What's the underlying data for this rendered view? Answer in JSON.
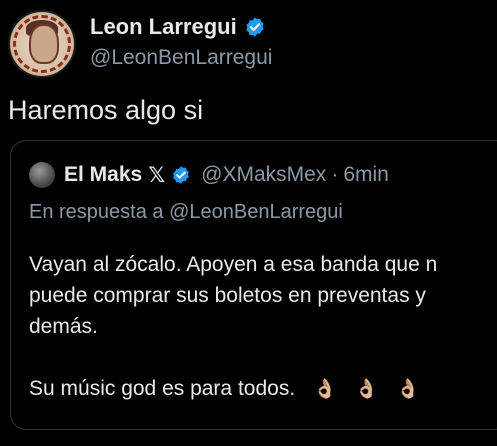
{
  "tweet": {
    "author_name": "Leon Larregui",
    "author_handle": "@LeonBenLarregui",
    "text": "Haremos algo si",
    "verified_color": "#1d9bf0"
  },
  "quoted_tweet": {
    "author_name": "El Maks",
    "x_logo": "𝕏",
    "author_handle": "@XMaksMex",
    "separator": "·",
    "time": "6min",
    "reply_to": "En respuesta a @LeonBenLarregui",
    "lines": [
      "Vayan al zócalo. Apoyen a esa banda que n",
      "puede comprar sus boletos en preventas y",
      "demás.",
      "Su músic god es para todos."
    ],
    "emojis": [
      "👌🏼",
      "👌🏼",
      "👌🏼"
    ]
  }
}
